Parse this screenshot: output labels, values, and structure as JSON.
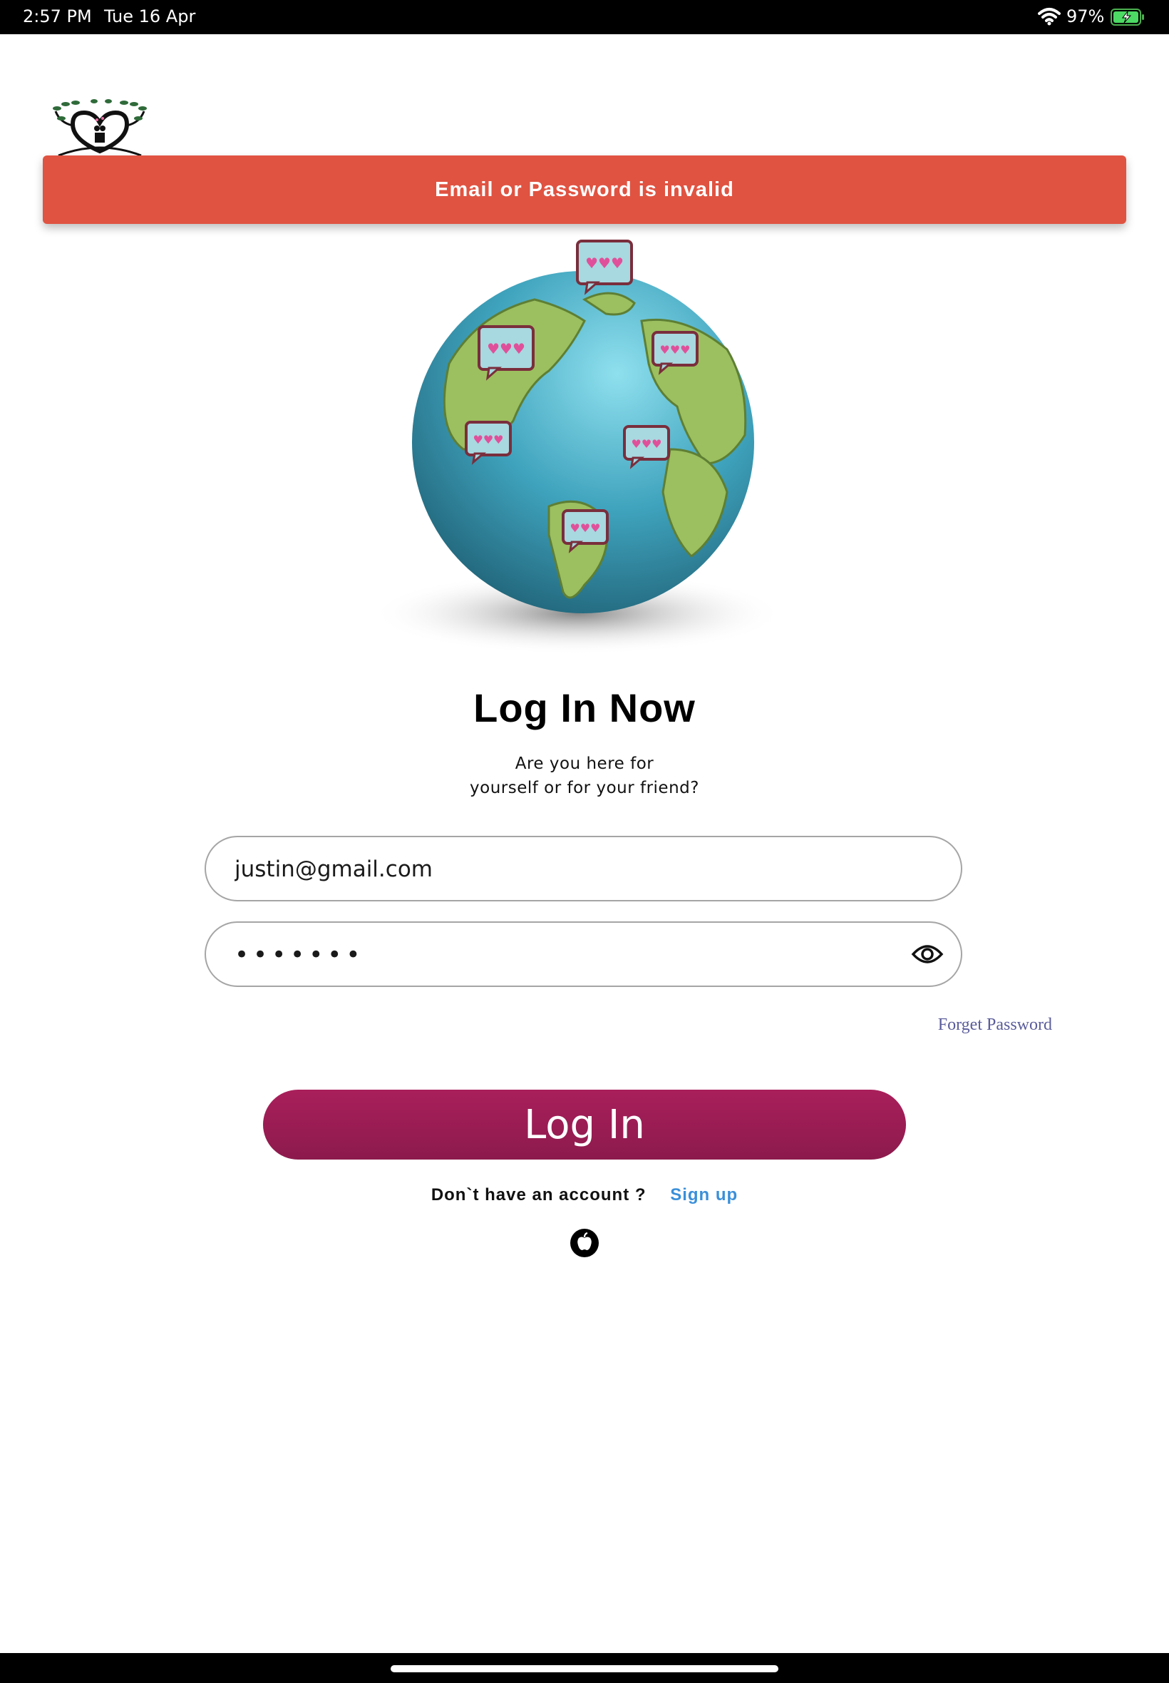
{
  "status_bar": {
    "time": "2:57 PM",
    "date": "Tue 16 Apr",
    "battery_percent": "97%"
  },
  "error_banner": {
    "message": "Email or Password is invalid",
    "color": "#e05341"
  },
  "login": {
    "title": "Log In Now",
    "subtitle_line1": "Are you here for",
    "subtitle_line2": "yourself or for your friend?",
    "email_value": "justin@gmail.com",
    "password_value": "•••••••",
    "forgot_password": "Forget Password",
    "login_button": "Log In",
    "no_account_text": "Don`t have an account ?",
    "signup_link": "Sign up"
  },
  "colors": {
    "primary_button": "#9b1d55",
    "link": "#3a8fd9",
    "forgot_link": "#5a5c9a"
  },
  "icons": [
    "wifi-icon",
    "battery-icon",
    "logo-icon",
    "globe-illustration",
    "eye-icon",
    "apple-icon"
  ]
}
